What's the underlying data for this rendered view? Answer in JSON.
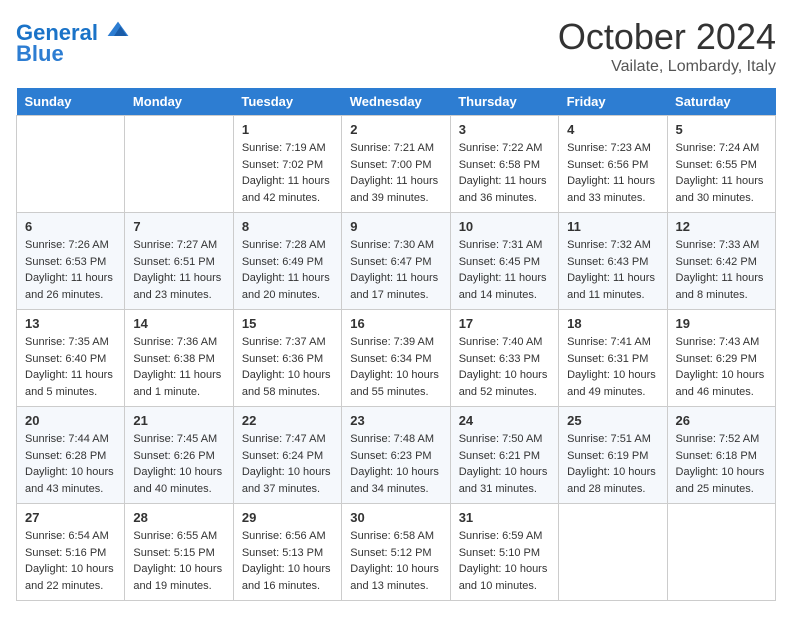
{
  "header": {
    "logo_line1": "General",
    "logo_line2": "Blue",
    "month": "October 2024",
    "location": "Vailate, Lombardy, Italy"
  },
  "days_of_week": [
    "Sunday",
    "Monday",
    "Tuesday",
    "Wednesday",
    "Thursday",
    "Friday",
    "Saturday"
  ],
  "weeks": [
    [
      {
        "day": "",
        "sunrise": "",
        "sunset": "",
        "daylight": ""
      },
      {
        "day": "",
        "sunrise": "",
        "sunset": "",
        "daylight": ""
      },
      {
        "day": "1",
        "sunrise": "Sunrise: 7:19 AM",
        "sunset": "Sunset: 7:02 PM",
        "daylight": "Daylight: 11 hours and 42 minutes."
      },
      {
        "day": "2",
        "sunrise": "Sunrise: 7:21 AM",
        "sunset": "Sunset: 7:00 PM",
        "daylight": "Daylight: 11 hours and 39 minutes."
      },
      {
        "day": "3",
        "sunrise": "Sunrise: 7:22 AM",
        "sunset": "Sunset: 6:58 PM",
        "daylight": "Daylight: 11 hours and 36 minutes."
      },
      {
        "day": "4",
        "sunrise": "Sunrise: 7:23 AM",
        "sunset": "Sunset: 6:56 PM",
        "daylight": "Daylight: 11 hours and 33 minutes."
      },
      {
        "day": "5",
        "sunrise": "Sunrise: 7:24 AM",
        "sunset": "Sunset: 6:55 PM",
        "daylight": "Daylight: 11 hours and 30 minutes."
      }
    ],
    [
      {
        "day": "6",
        "sunrise": "Sunrise: 7:26 AM",
        "sunset": "Sunset: 6:53 PM",
        "daylight": "Daylight: 11 hours and 26 minutes."
      },
      {
        "day": "7",
        "sunrise": "Sunrise: 7:27 AM",
        "sunset": "Sunset: 6:51 PM",
        "daylight": "Daylight: 11 hours and 23 minutes."
      },
      {
        "day": "8",
        "sunrise": "Sunrise: 7:28 AM",
        "sunset": "Sunset: 6:49 PM",
        "daylight": "Daylight: 11 hours and 20 minutes."
      },
      {
        "day": "9",
        "sunrise": "Sunrise: 7:30 AM",
        "sunset": "Sunset: 6:47 PM",
        "daylight": "Daylight: 11 hours and 17 minutes."
      },
      {
        "day": "10",
        "sunrise": "Sunrise: 7:31 AM",
        "sunset": "Sunset: 6:45 PM",
        "daylight": "Daylight: 11 hours and 14 minutes."
      },
      {
        "day": "11",
        "sunrise": "Sunrise: 7:32 AM",
        "sunset": "Sunset: 6:43 PM",
        "daylight": "Daylight: 11 hours and 11 minutes."
      },
      {
        "day": "12",
        "sunrise": "Sunrise: 7:33 AM",
        "sunset": "Sunset: 6:42 PM",
        "daylight": "Daylight: 11 hours and 8 minutes."
      }
    ],
    [
      {
        "day": "13",
        "sunrise": "Sunrise: 7:35 AM",
        "sunset": "Sunset: 6:40 PM",
        "daylight": "Daylight: 11 hours and 5 minutes."
      },
      {
        "day": "14",
        "sunrise": "Sunrise: 7:36 AM",
        "sunset": "Sunset: 6:38 PM",
        "daylight": "Daylight: 11 hours and 1 minute."
      },
      {
        "day": "15",
        "sunrise": "Sunrise: 7:37 AM",
        "sunset": "Sunset: 6:36 PM",
        "daylight": "Daylight: 10 hours and 58 minutes."
      },
      {
        "day": "16",
        "sunrise": "Sunrise: 7:39 AM",
        "sunset": "Sunset: 6:34 PM",
        "daylight": "Daylight: 10 hours and 55 minutes."
      },
      {
        "day": "17",
        "sunrise": "Sunrise: 7:40 AM",
        "sunset": "Sunset: 6:33 PM",
        "daylight": "Daylight: 10 hours and 52 minutes."
      },
      {
        "day": "18",
        "sunrise": "Sunrise: 7:41 AM",
        "sunset": "Sunset: 6:31 PM",
        "daylight": "Daylight: 10 hours and 49 minutes."
      },
      {
        "day": "19",
        "sunrise": "Sunrise: 7:43 AM",
        "sunset": "Sunset: 6:29 PM",
        "daylight": "Daylight: 10 hours and 46 minutes."
      }
    ],
    [
      {
        "day": "20",
        "sunrise": "Sunrise: 7:44 AM",
        "sunset": "Sunset: 6:28 PM",
        "daylight": "Daylight: 10 hours and 43 minutes."
      },
      {
        "day": "21",
        "sunrise": "Sunrise: 7:45 AM",
        "sunset": "Sunset: 6:26 PM",
        "daylight": "Daylight: 10 hours and 40 minutes."
      },
      {
        "day": "22",
        "sunrise": "Sunrise: 7:47 AM",
        "sunset": "Sunset: 6:24 PM",
        "daylight": "Daylight: 10 hours and 37 minutes."
      },
      {
        "day": "23",
        "sunrise": "Sunrise: 7:48 AM",
        "sunset": "Sunset: 6:23 PM",
        "daylight": "Daylight: 10 hours and 34 minutes."
      },
      {
        "day": "24",
        "sunrise": "Sunrise: 7:50 AM",
        "sunset": "Sunset: 6:21 PM",
        "daylight": "Daylight: 10 hours and 31 minutes."
      },
      {
        "day": "25",
        "sunrise": "Sunrise: 7:51 AM",
        "sunset": "Sunset: 6:19 PM",
        "daylight": "Daylight: 10 hours and 28 minutes."
      },
      {
        "day": "26",
        "sunrise": "Sunrise: 7:52 AM",
        "sunset": "Sunset: 6:18 PM",
        "daylight": "Daylight: 10 hours and 25 minutes."
      }
    ],
    [
      {
        "day": "27",
        "sunrise": "Sunrise: 6:54 AM",
        "sunset": "Sunset: 5:16 PM",
        "daylight": "Daylight: 10 hours and 22 minutes."
      },
      {
        "day": "28",
        "sunrise": "Sunrise: 6:55 AM",
        "sunset": "Sunset: 5:15 PM",
        "daylight": "Daylight: 10 hours and 19 minutes."
      },
      {
        "day": "29",
        "sunrise": "Sunrise: 6:56 AM",
        "sunset": "Sunset: 5:13 PM",
        "daylight": "Daylight: 10 hours and 16 minutes."
      },
      {
        "day": "30",
        "sunrise": "Sunrise: 6:58 AM",
        "sunset": "Sunset: 5:12 PM",
        "daylight": "Daylight: 10 hours and 13 minutes."
      },
      {
        "day": "31",
        "sunrise": "Sunrise: 6:59 AM",
        "sunset": "Sunset: 5:10 PM",
        "daylight": "Daylight: 10 hours and 10 minutes."
      },
      {
        "day": "",
        "sunrise": "",
        "sunset": "",
        "daylight": ""
      },
      {
        "day": "",
        "sunrise": "",
        "sunset": "",
        "daylight": ""
      }
    ]
  ]
}
